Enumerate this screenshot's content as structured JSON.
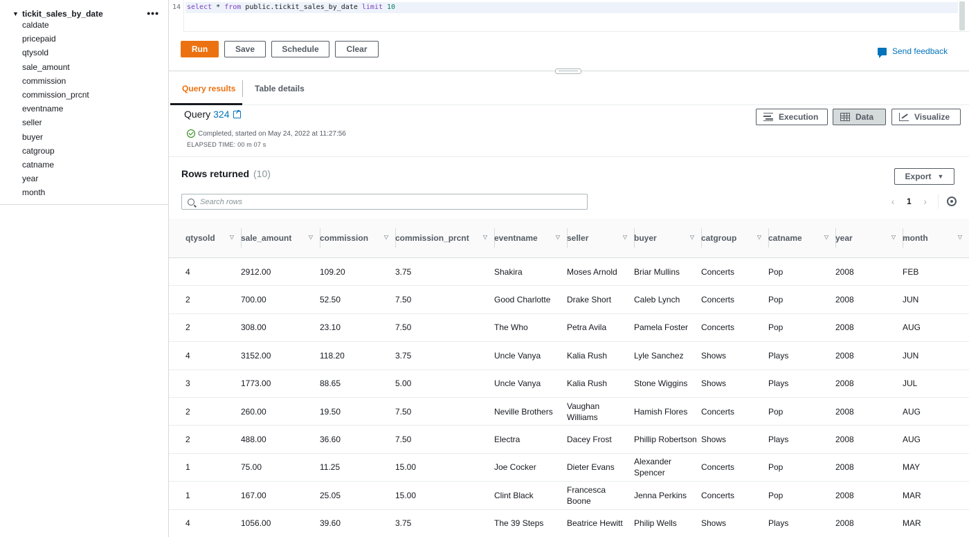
{
  "sidebar": {
    "table_name": "tickit_sales_by_date",
    "columns": [
      "caldate",
      "pricepaid",
      "qtysold",
      "sale_amount",
      "commission",
      "commission_prcnt",
      "eventname",
      "seller",
      "buyer",
      "catgroup",
      "catname",
      "year",
      "month"
    ]
  },
  "editor": {
    "line_number": "14",
    "code": {
      "kw1": "select",
      "mid": " * ",
      "kw2": "from",
      "ident": " public.tickit_sales_by_date ",
      "kw3": "limit",
      "num": " 10"
    }
  },
  "toolbar": {
    "run": "Run",
    "save": "Save",
    "schedule": "Schedule",
    "clear": "Clear",
    "feedback": "Send feedback"
  },
  "tabs": {
    "query_results": "Query results",
    "table_details": "Table details"
  },
  "query": {
    "label": "Query",
    "number": "324",
    "status": "Completed, started on May 24, 2022 at 11:27:56",
    "elapsed": "ELAPSED TIME: 00 m 07 s"
  },
  "view_buttons": {
    "execution": "Execution",
    "data": "Data",
    "visualize": "Visualize"
  },
  "results": {
    "title": "Rows returned",
    "count": "(10)",
    "export": "Export",
    "search_placeholder": "Search rows",
    "page": "1",
    "headers": [
      "qtysold",
      "sale_amount",
      "commission",
      "commission_prcnt",
      "eventname",
      "seller",
      "buyer",
      "catgroup",
      "catname",
      "year",
      "month"
    ],
    "rows": [
      [
        "4",
        "2912.00",
        "109.20",
        "3.75",
        "Shakira",
        "Moses Arnold",
        "Briar Mullins",
        "Concerts",
        "Pop",
        "2008",
        "FEB"
      ],
      [
        "2",
        "700.00",
        "52.50",
        "7.50",
        "Good Charlotte",
        "Drake Short",
        "Caleb Lynch",
        "Concerts",
        "Pop",
        "2008",
        "JUN"
      ],
      [
        "2",
        "308.00",
        "23.10",
        "7.50",
        "The Who",
        "Petra Avila",
        "Pamela Foster",
        "Concerts",
        "Pop",
        "2008",
        "AUG"
      ],
      [
        "4",
        "3152.00",
        "118.20",
        "3.75",
        "Uncle Vanya",
        "Kalia Rush",
        "Lyle Sanchez",
        "Shows",
        "Plays",
        "2008",
        "JUN"
      ],
      [
        "3",
        "1773.00",
        "88.65",
        "5.00",
        "Uncle Vanya",
        "Kalia Rush",
        "Stone Wiggins",
        "Shows",
        "Plays",
        "2008",
        "JUL"
      ],
      [
        "2",
        "260.00",
        "19.50",
        "7.50",
        "Neville Brothers",
        "Vaughan Williams",
        "Hamish Flores",
        "Concerts",
        "Pop",
        "2008",
        "AUG"
      ],
      [
        "2",
        "488.00",
        "36.60",
        "7.50",
        "Electra",
        "Dacey Frost",
        "Phillip Robertson",
        "Shows",
        "Plays",
        "2008",
        "AUG"
      ],
      [
        "1",
        "75.00",
        "11.25",
        "15.00",
        "Joe Cocker",
        "Dieter Evans",
        "Alexander Spencer",
        "Concerts",
        "Pop",
        "2008",
        "MAY"
      ],
      [
        "1",
        "167.00",
        "25.05",
        "15.00",
        "Clint Black",
        "Francesca Boone",
        "Jenna Perkins",
        "Concerts",
        "Pop",
        "2008",
        "MAR"
      ],
      [
        "4",
        "1056.00",
        "39.60",
        "3.75",
        "The 39 Steps",
        "Beatrice Hewitt",
        "Philip Wells",
        "Shows",
        "Plays",
        "2008",
        "MAR"
      ]
    ]
  },
  "colors": {
    "accent": "#ec7211",
    "link": "#0073bb",
    "success": "#1d8102"
  },
  "icons": {
    "tree_toggle": "caret-down-icon",
    "tree_more": "ellipsis-icon",
    "query_link": "external-link-icon",
    "status": "check-circle-icon",
    "feedback": "feedback-icon",
    "execution": "list-icon",
    "data": "table-grid-icon",
    "visualize": "line-chart-icon",
    "search": "search-icon",
    "settings": "gear-icon"
  }
}
